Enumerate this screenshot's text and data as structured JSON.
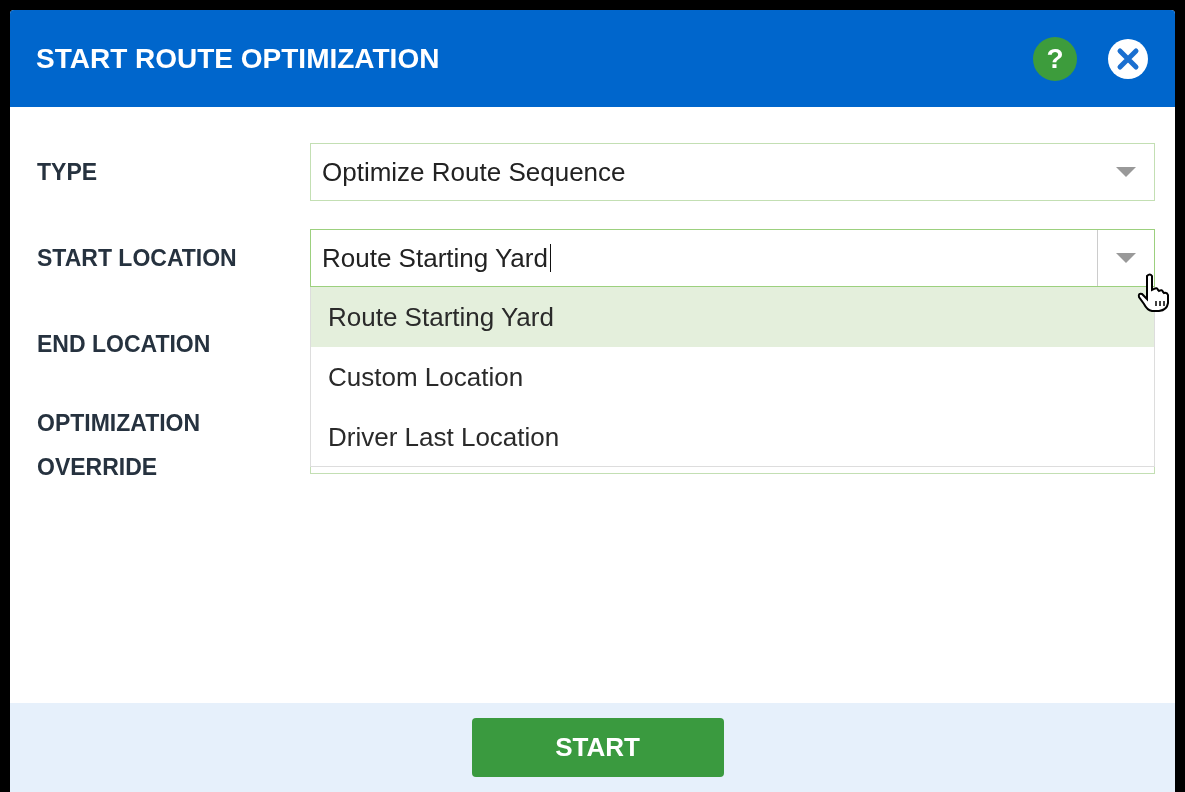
{
  "dialog": {
    "title": "START ROUTE OPTIMIZATION",
    "help": "?"
  },
  "fields": [
    {
      "label": "TYPE",
      "value": "Optimize Route Sequence",
      "focused": false
    },
    {
      "label": "START LOCATION",
      "value": "Route Starting Yard",
      "focused": true
    },
    {
      "label": "END LOCATION"
    },
    {
      "label": "OPTIMIZATION OVERRIDE"
    }
  ],
  "dropdown": {
    "options": [
      {
        "label": "Route Starting Yard",
        "selected": true
      },
      {
        "label": "Custom Location",
        "selected": false
      },
      {
        "label": "Driver Last Location",
        "selected": false
      }
    ]
  },
  "button": "START"
}
